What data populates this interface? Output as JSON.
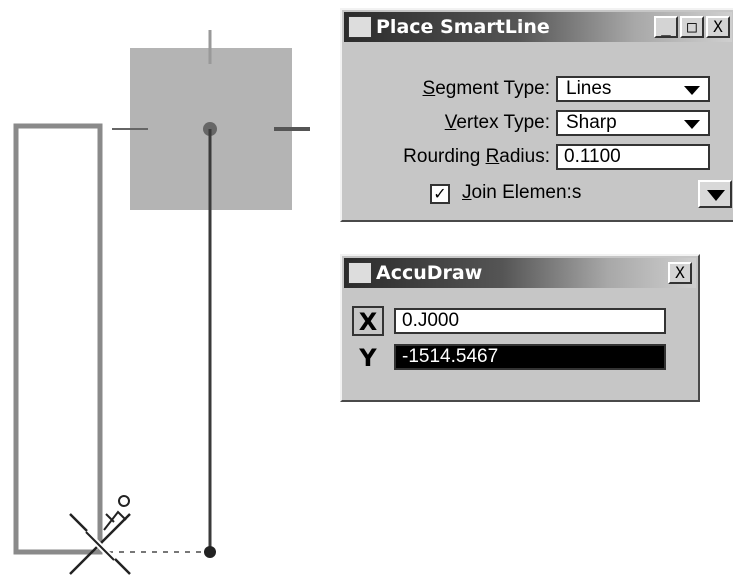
{
  "place_smartline": {
    "title": "Place SmartLine",
    "buttons": {
      "minimize": "_",
      "maximize": "□",
      "close": "X"
    },
    "segment_type_label_u": "S",
    "segment_type_label_rest": "egment Type:",
    "segment_type_value": "Lines",
    "vertex_type_label_u": "V",
    "vertex_type_label_rest": "ertex Type:",
    "vertex_type_value": "Sharp",
    "rounding_radius_label_pre": "Rourding ",
    "rounding_radius_label_u": "R",
    "rounding_radius_label_rest": "adius:",
    "rounding_radius_value": "0.1100",
    "join_elements_checked": true,
    "join_elements_check_glyph": "✓",
    "join_elements_label_u": "J",
    "join_elements_label_rest": "oin Elemen:s"
  },
  "accudraw": {
    "title": "AccuDraw",
    "close": "X",
    "x_label": "X",
    "x_value": "0.J000",
    "y_label": "Y",
    "y_value": "-1514.5467"
  },
  "icons": {
    "app_icon": "microstation-logo-icon",
    "cursor": "crosshair-x-cursor-icon",
    "tool": "smartline-tool-icon"
  },
  "colors": {
    "dialog_bg": "#c6c6c6",
    "highlight_field_bg": "#000000",
    "highlight_field_fg": "#ffffff",
    "pointer_square": "#b4b4b4",
    "rectangle_stroke": "#8a8a8a"
  }
}
